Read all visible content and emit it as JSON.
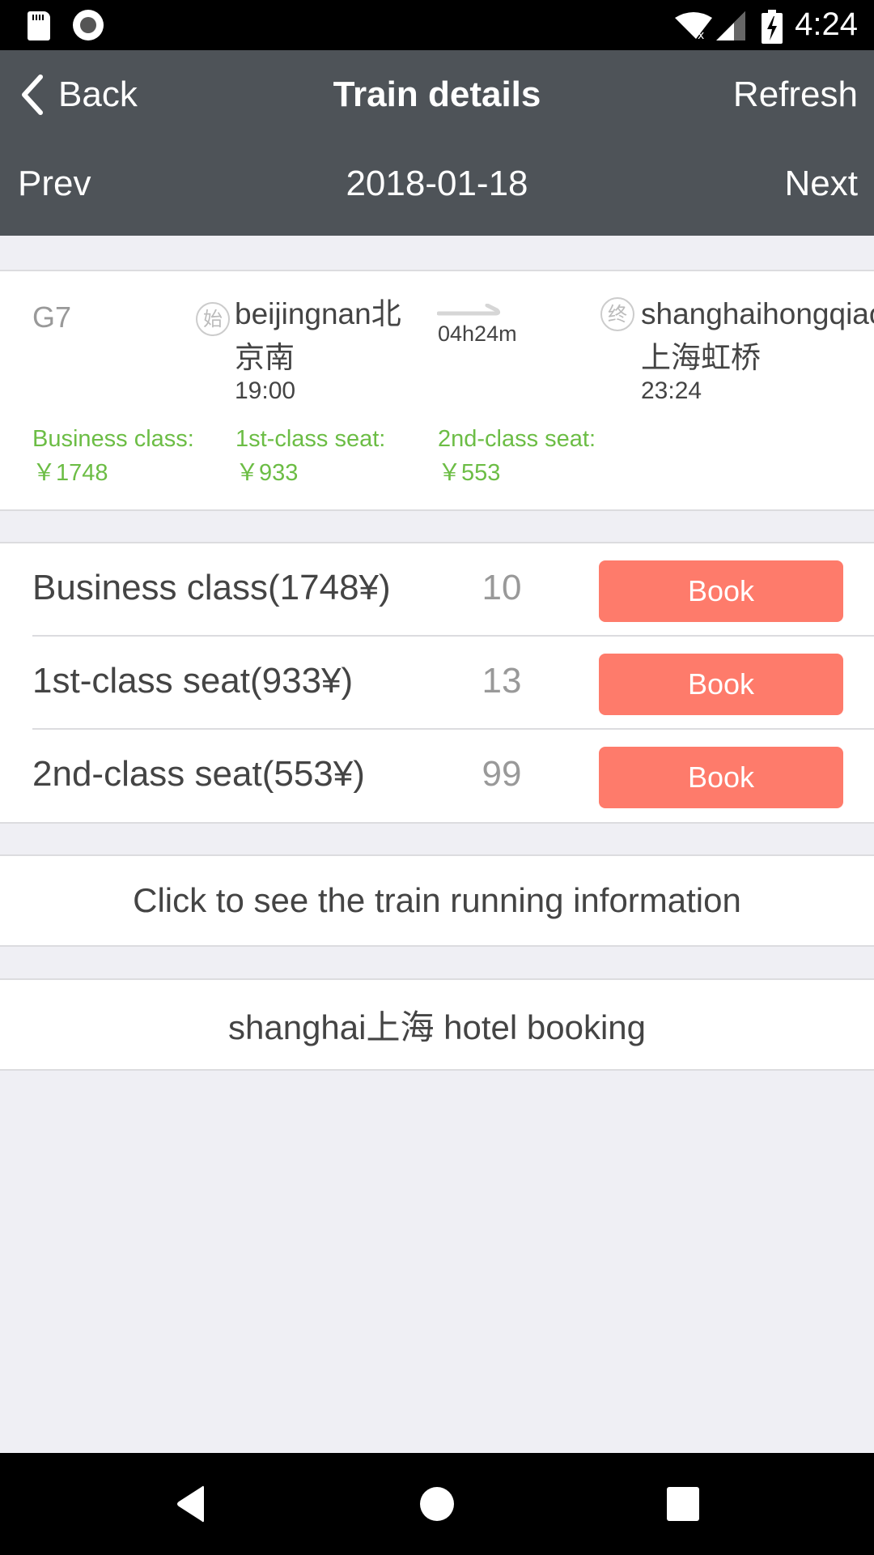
{
  "status_bar": {
    "time": "4:24",
    "icons": [
      "sd-card-icon",
      "record-icon",
      "wifi-off-icon",
      "cell-signal-icon",
      "battery-charging-icon"
    ]
  },
  "header": {
    "back_label": "Back",
    "title": "Train details",
    "refresh_label": "Refresh",
    "prev_label": "Prev",
    "date": "2018-01-18",
    "next_label": "Next"
  },
  "train": {
    "number": "G7",
    "departure": {
      "badge": "始",
      "station_pinyin": "beijingnan",
      "station_cn_1": "北",
      "station_cn_2": "京南",
      "time": "19:00"
    },
    "duration": "04h24m",
    "arrival": {
      "badge": "终",
      "station_pinyin": "shanghaihongqiao",
      "station_cn": "上海虹桥",
      "time": "23:24"
    },
    "fares": [
      {
        "label": "Business class:",
        "price": "￥1748"
      },
      {
        "label": "1st-class seat:",
        "price": "￥933"
      },
      {
        "label": "2nd-class seat:",
        "price": "￥553"
      }
    ]
  },
  "seats": [
    {
      "name": "Business class(1748¥)",
      "count": "10",
      "button": "Book"
    },
    {
      "name": "1st-class seat(933¥)",
      "count": "13",
      "button": "Book"
    },
    {
      "name": "2nd-class seat(553¥)",
      "count": "99",
      "button": "Book"
    }
  ],
  "links": {
    "running_info": "Click to see the train running information",
    "hotel": "shanghai上海 hotel booking"
  },
  "colors": {
    "header_bg": "#4e5358",
    "fare_green": "#6cbd45",
    "book_button": "#fe7b6b",
    "page_bg": "#efeff4"
  },
  "nav_bar": {
    "buttons": [
      "back",
      "home",
      "recent-apps"
    ]
  }
}
